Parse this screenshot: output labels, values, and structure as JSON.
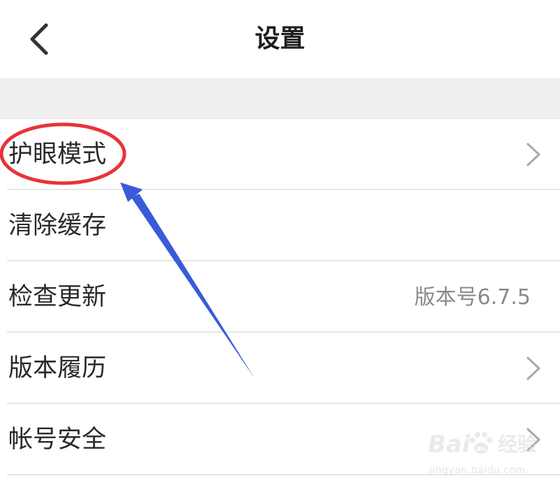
{
  "header": {
    "title": "设置",
    "back_icon": "chevron-left-icon"
  },
  "settings": {
    "items": [
      {
        "label": "护眼模式",
        "value": "",
        "chevron": true
      },
      {
        "label": "清除缓存",
        "value": "",
        "chevron": false
      },
      {
        "label": "检查更新",
        "value": "版本号6.7.5",
        "chevron": false
      },
      {
        "label": "版本履历",
        "value": "",
        "chevron": true
      },
      {
        "label": "帐号安全",
        "value": "",
        "chevron": true
      }
    ]
  },
  "annotation": {
    "highlight_color": "#e8333a",
    "arrow_color": "#3a5bd9",
    "highlighted_item": "护眼模式"
  },
  "watermark": {
    "logo_left": "Bai",
    "logo_right": "du",
    "brand": "经验",
    "url": "jingyan.baidu.com"
  },
  "colors": {
    "background": "#ffffff",
    "band": "#efefef",
    "divider": "#e6e6e6",
    "text": "#2a2a2a",
    "secondary_text": "#8a8a8a",
    "chevron": "#a8a8a8"
  }
}
